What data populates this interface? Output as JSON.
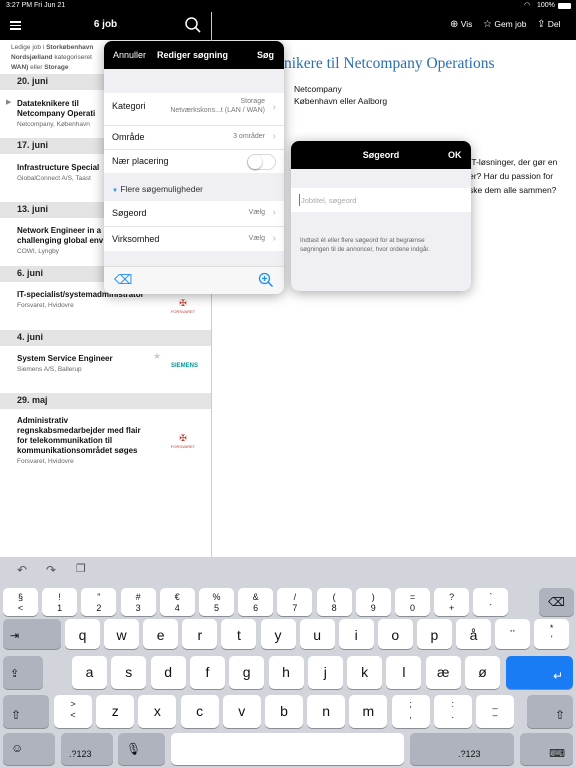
{
  "status": {
    "time": "3:27 PM",
    "date": "Fri Jun 21",
    "battery": "100%"
  },
  "leftnav": {
    "title": "6 job"
  },
  "rightnav": {
    "vis": "Vis",
    "gem": "Gem job",
    "del": "Del"
  },
  "intro": {
    "line1a": "Ledige job i ",
    "line1b": "Storkøbenhavn",
    "line2a": "Nordsjælland",
    "line2b": " kategoriseret",
    "line3a": "WAN)",
    "line3b": " eller ",
    "line3c": "Storage"
  },
  "sections": [
    "20. juni",
    "17. juni",
    "13. juni",
    "6. juni",
    "4. juni",
    "29. maj"
  ],
  "jobs": [
    {
      "title1": "Datateknikere til",
      "title2": "Netcompany Operati",
      "sub": "Netcompany, København"
    },
    {
      "title1": "Infrastructure Special",
      "title2": "",
      "sub": "GlobalConnect A/S, Taast"
    },
    {
      "title1": "Network Engineer in a",
      "title2": "challenging global env",
      "sub": "COWI, Lyngby"
    },
    {
      "title1": "IT-specialist/systemadministrator",
      "title2": "",
      "sub": "Forsvaret, Hvidovre"
    },
    {
      "title1": "System Service Engineer",
      "title2": "",
      "sub": "Siemens A/S, Ballerup"
    },
    {
      "title1": "Administrativ",
      "title2": "regnskabsmedarbejder med flair",
      "title3": "for telekommunikation til",
      "title4": "kommunikationsområdet søges",
      "sub": "Forsvaret, Hvidovre"
    }
  ],
  "logos": {
    "forsvaret": "FORSVARET",
    "siemens": "SIEMENS"
  },
  "detail": {
    "title": "nikere til Netcompany Operations",
    "company": "Netcompany",
    "location": "København eller Aalborg",
    "p1": "IT-løsninger, der gør en",
    "p2": "er? Har du passion for",
    "p3": "ske dem alle sammen?"
  },
  "popover": {
    "cancel": "Annuller",
    "title": "Rediger søgning",
    "search": "Søg",
    "kategori_label": "Kategori",
    "kategori_v1": "Storage",
    "kategori_v2": "Netværkskons...t (LAN / WAN)",
    "omraade_label": "Område",
    "omraade_value": "3 områder",
    "naer_label": "Nær placering",
    "flere": "Flere søgemuligheder",
    "soegeord_label": "Søgeord",
    "soegeord_value": "Vælg",
    "virksomhed_label": "Virksomhed",
    "virksomhed_value": "Vælg"
  },
  "dialog": {
    "title": "Søgeord",
    "ok": "OK",
    "placeholder": "Jobtitel, søgeord",
    "help1": "Indtast ét eller flere søgeord for at begrænse",
    "help2": "søgningen til de annoncer, hvor ordene indgår."
  },
  "keyboard": {
    "row1": [
      [
        "§",
        "<"
      ],
      [
        "!",
        "1"
      ],
      [
        "\"",
        "2"
      ],
      [
        "#",
        "3"
      ],
      [
        "€",
        "4"
      ],
      [
        "%",
        "5"
      ],
      [
        "&",
        "6"
      ],
      [
        "/",
        "7"
      ],
      [
        "(",
        "8"
      ],
      [
        ")",
        "9"
      ],
      [
        "=",
        "0"
      ],
      [
        "?",
        "+"
      ],
      [
        "`",
        "´"
      ]
    ],
    "row2": [
      "q",
      "w",
      "e",
      "r",
      "t",
      "y",
      "u",
      "i",
      "o",
      "p",
      "å",
      "¨",
      [
        "*",
        "'"
      ]
    ],
    "row3": [
      "a",
      "s",
      "d",
      "f",
      "g",
      "h",
      "j",
      "k",
      "l",
      "æ",
      "ø"
    ],
    "row4": [
      [
        ">",
        "<"
      ],
      "z",
      "x",
      "c",
      "v",
      "b",
      "n",
      "m",
      [
        ";",
        ","
      ],
      [
        ":",
        "."
      ],
      [
        "_",
        "–"
      ]
    ],
    "num_label": ".?123"
  },
  "colors": {
    "accent": "#1a8cff",
    "title_blue": "#2a6fb0",
    "return_key": "#1a7cf5"
  }
}
